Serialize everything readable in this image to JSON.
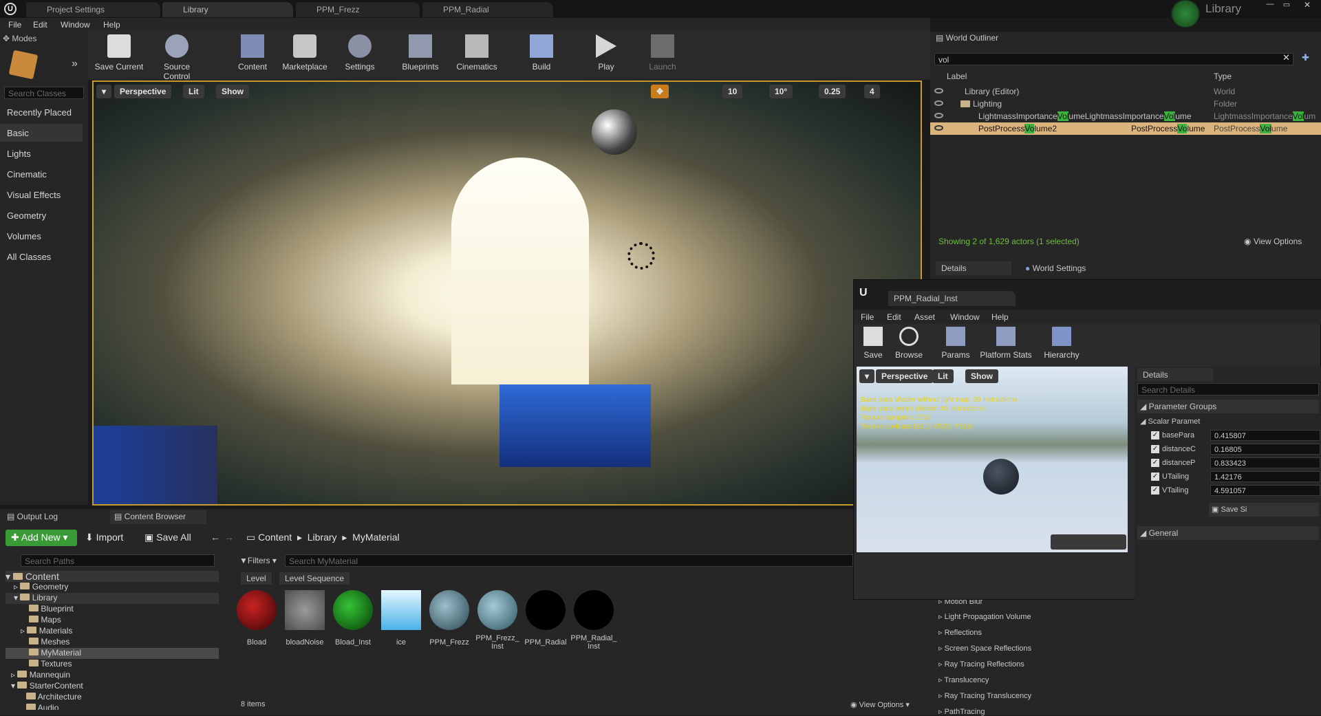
{
  "window": {
    "tabs": [
      "Project Settings",
      "Library",
      "PPM_Frezz",
      "PPM_Radial"
    ],
    "project_name": "Library"
  },
  "menubar": [
    "File",
    "Edit",
    "Window",
    "Help"
  ],
  "modes": {
    "title": "Modes",
    "search_placeholder": "Search Classes",
    "categories": [
      "Recently Placed",
      "Basic",
      "Lights",
      "Cinematic",
      "Visual Effects",
      "Geometry",
      "Volumes",
      "All Classes"
    ],
    "selected": "Basic"
  },
  "toolbar": {
    "buttons": [
      "Save Current",
      "Source Control",
      "Content",
      "Marketplace",
      "Settings",
      "Blueprints",
      "Cinematics",
      "Build",
      "Play",
      "Launch"
    ]
  },
  "viewport": {
    "perspective": "Perspective",
    "lit": "Lit",
    "show": "Show",
    "grid": "10",
    "angle": "10°",
    "scale": "0.25",
    "camera": "4"
  },
  "outliner": {
    "title": "World Outliner",
    "search": "vol",
    "col_label": "Label",
    "col_type": "Type",
    "rows": [
      {
        "label": "Library (Editor)",
        "type": "World"
      },
      {
        "label": "Lighting",
        "type": "Folder"
      },
      {
        "label_pre": "LightmassImportance",
        "label_hl": "Vol",
        "label_post": "umeLightmassImportance",
        "label_hl2": "Vol",
        "label_post2": "ume",
        "type_pre": "LightmassImportance",
        "type_hl": "Vol",
        "type_post": "um"
      },
      {
        "label_pre": "PostProcess",
        "label_hl": "Vo",
        "label_post": "lume2",
        "mid_pre": "PostProcess",
        "mid_hl": "Vo",
        "mid_post": "lume",
        "type_pre": "PostProcess",
        "type_hl": "Vol",
        "type_post": "ume"
      }
    ],
    "status": "Showing 2 of 1,629 actors (1 selected)",
    "view_options": "View Options"
  },
  "details": {
    "tab1": "Details",
    "tab2": "World Settings",
    "sections": [
      "Motion Blur",
      "Light Propagation Volume",
      "Reflections",
      "Screen Space Reflections",
      "Ray Tracing Reflections",
      "Translucency",
      "Ray Tracing Translucency",
      "PathTracing"
    ]
  },
  "bottom": {
    "tab1": "Output Log",
    "tab2": "Content Browser",
    "add_new": "Add New",
    "import": "Import",
    "save_all": "Save All",
    "breadcrumb": [
      "Content",
      "Library",
      "MyMaterial"
    ],
    "search_paths": "Search Paths",
    "filters": "Filters",
    "search_asset": "Search MyMaterial",
    "filter_chips": [
      "Level",
      "Level Sequence"
    ],
    "tree": [
      "Content",
      "Geometry",
      "Library",
      "Blueprint",
      "Maps",
      "Materials",
      "Meshes",
      "MyMaterial",
      "Textures",
      "Mannequin",
      "StarterContent",
      "Architecture",
      "Audio"
    ],
    "assets": [
      "Bload",
      "bloadNoise",
      "Bload_Inst",
      "ice",
      "PPM_Frezz",
      "PPM_Frezz_\nInst",
      "PPM_Radial",
      "PPM_Radial_\nInst"
    ],
    "item_count": "8 items",
    "view_options": "View Options"
  },
  "material_editor": {
    "tab": "PPM_Radial_Inst",
    "menu": [
      "File",
      "Edit",
      "Asset",
      "Window",
      "Help"
    ],
    "tools": [
      "Save",
      "Browse",
      "Params",
      "Platform Stats",
      "Hierarchy"
    ],
    "vp_perspective": "Perspective",
    "vp_lit": "Lit",
    "vp_show": "Show",
    "stats": [
      "Base pass shader without light map: 39 instructions",
      "Base pass vertex shader: 44 instructions",
      "Texture samplers: 2/16",
      "Texture Lookups (Est.): VS(0), PS(5)"
    ],
    "details_tab": "Details",
    "search_details": "Search Details",
    "param_groups": "Parameter Groups",
    "scalar": "Scalar Paramet",
    "params": [
      {
        "name": "basePara",
        "value": "0.415807"
      },
      {
        "name": "distanceC",
        "value": "0.16805"
      },
      {
        "name": "distanceP",
        "value": "0.833423"
      },
      {
        "name": "UTailing",
        "value": "1.42176"
      },
      {
        "name": "VTailing",
        "value": "4.591057"
      }
    ],
    "save_label": "Save Si",
    "general": "General"
  }
}
